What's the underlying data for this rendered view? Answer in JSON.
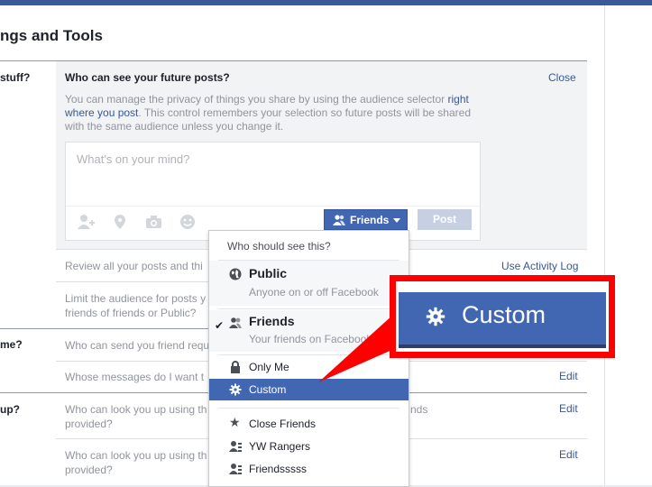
{
  "page": {
    "title": "ngs and Tools"
  },
  "sections": [
    {
      "label": "stuff?"
    },
    {
      "label": "me?"
    },
    {
      "label": "up?"
    }
  ],
  "expanded": {
    "title": "Who can see your future posts?",
    "close": "Close",
    "desc_before": "You can manage the privacy of things you share by using the audience selector ",
    "desc_link": "right where you post",
    "desc_after": ". This control remembers your selection so future posts will be shared with the same audience unless you change it.",
    "composer_placeholder": "What's on your mind?",
    "friends_button": "Friends",
    "post_button": "Post"
  },
  "rows": [
    {
      "text": "Review all your posts and thi",
      "action": "Use Activity Log"
    },
    {
      "text_line1": "Limit the audience for posts y",
      "text_line2": "friends of friends or Public?"
    },
    {
      "text": "Who can send you friend requ"
    },
    {
      "text": "Whose messages do I want t",
      "action": "Edit"
    },
    {
      "text_line1": "Who can look you up using th",
      "text_line2": "provided?",
      "extra": "nds",
      "action": "Edit"
    },
    {
      "text_line1": "Who can look you up using th",
      "text_line2": "provided?",
      "action": "Edit"
    }
  ],
  "dropdown": {
    "header": "Who should see this?",
    "public": {
      "title": "Public",
      "subtitle": "Anyone on or off Facebook"
    },
    "friends": {
      "title": "Friends",
      "subtitle": "Your friends on Facebook",
      "checked": true
    },
    "only_me": "Only Me",
    "custom": "Custom",
    "close_friends": "Close Friends",
    "list1": "YW Rangers",
    "list2": "Friendsssss"
  },
  "callout": {
    "label": "Custom"
  },
  "colors": {
    "accent": "#4267b2",
    "highlight": "#ff0000",
    "link": "#365899"
  }
}
